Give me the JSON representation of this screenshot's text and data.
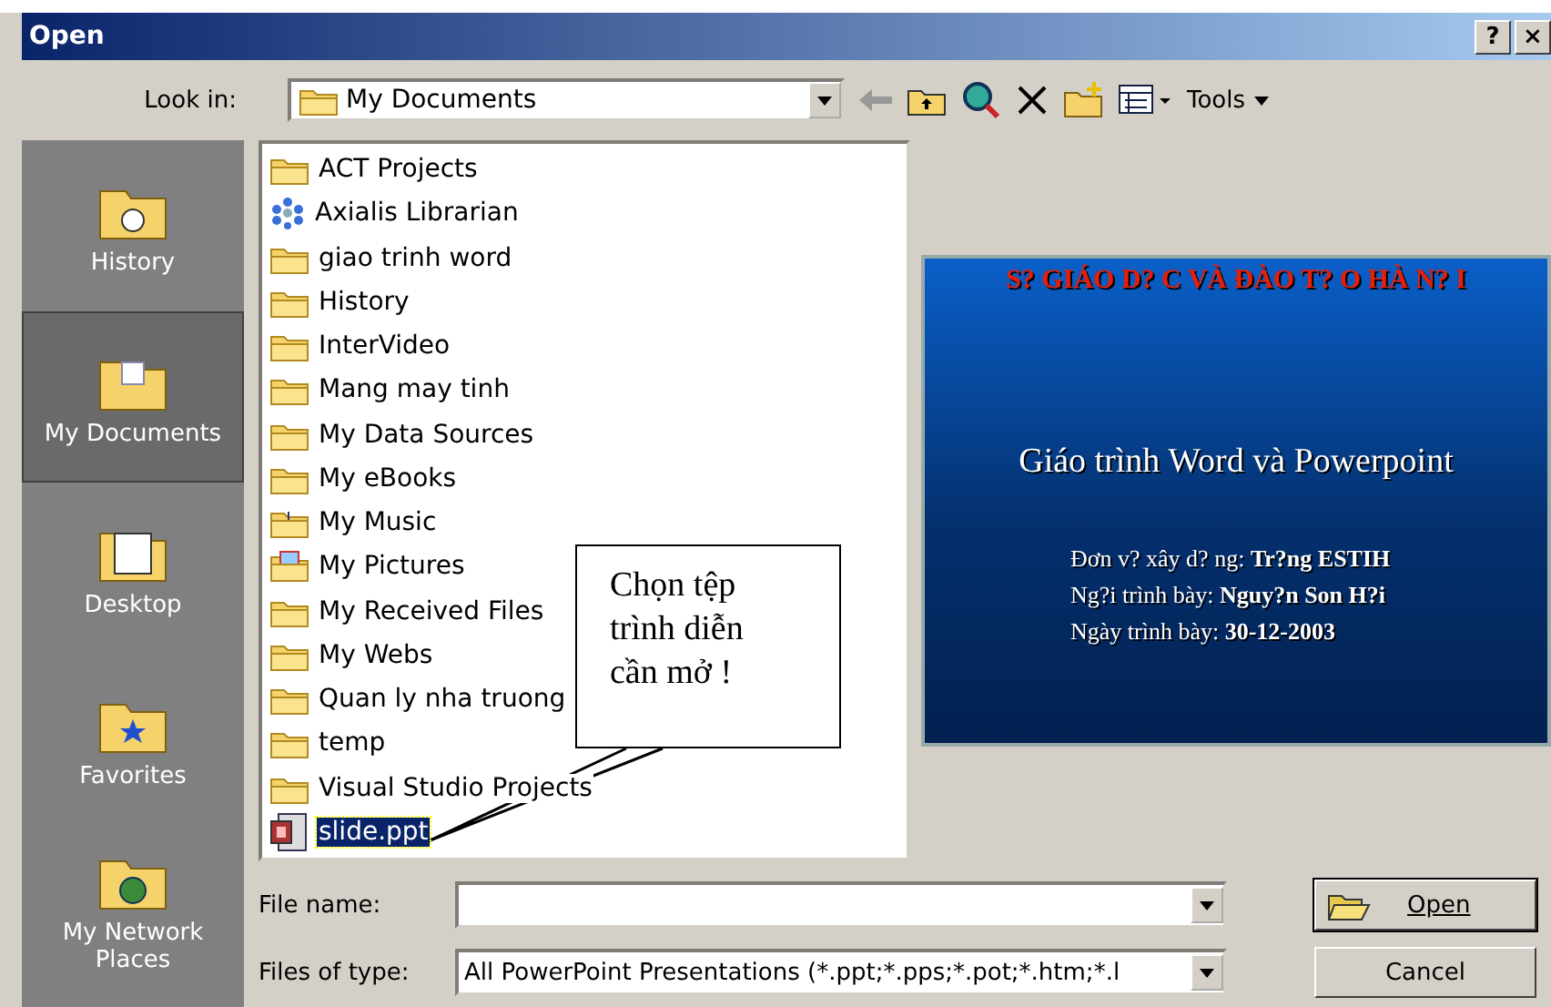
{
  "window": {
    "title": "Open",
    "help_button": "?",
    "close_button": "×"
  },
  "toolbar": {
    "look_in_label": "Look in:",
    "look_in_value": "My Documents",
    "tools": "Tools"
  },
  "places": [
    {
      "label": "History",
      "kind": "history",
      "selected": false
    },
    {
      "label": "My Documents",
      "kind": "documents",
      "selected": true
    },
    {
      "label": "Desktop",
      "kind": "desktop",
      "selected": false
    },
    {
      "label": "Favorites",
      "kind": "favorites",
      "selected": false
    },
    {
      "label": "My Network Places",
      "kind": "network",
      "selected": false
    }
  ],
  "files": [
    {
      "name": "ACT Projects",
      "kind": "folder",
      "selected": false
    },
    {
      "name": "Axialis Librarian",
      "kind": "app",
      "selected": false
    },
    {
      "name": "giao trinh word",
      "kind": "folder",
      "selected": false
    },
    {
      "name": "History",
      "kind": "folder",
      "selected": false
    },
    {
      "name": "InterVideo",
      "kind": "folder",
      "selected": false
    },
    {
      "name": "Mang may tinh",
      "kind": "folder",
      "selected": false
    },
    {
      "name": "My Data Sources",
      "kind": "folder",
      "selected": false
    },
    {
      "name": "My eBooks",
      "kind": "folder",
      "selected": false
    },
    {
      "name": "My Music",
      "kind": "music",
      "selected": false
    },
    {
      "name": "My Pictures",
      "kind": "pictures",
      "selected": false
    },
    {
      "name": "My Received Files",
      "kind": "folder",
      "selected": false
    },
    {
      "name": "My Webs",
      "kind": "folder",
      "selected": false
    },
    {
      "name": "Quan ly nha truong",
      "kind": "folder",
      "selected": false
    },
    {
      "name": "temp",
      "kind": "folder",
      "selected": false
    },
    {
      "name": "Visual Studio Projects",
      "kind": "folder",
      "selected": false
    },
    {
      "name": "slide.ppt",
      "kind": "ppt",
      "selected": true
    }
  ],
  "preview": {
    "heading": "S?  GIÁO D? C VÀ ĐÀO T? O HÀ N? I",
    "title": "Giáo trình Word và Powerpoint",
    "lines": [
      "Đơn v? xây d? ng: **Tr?ng ESTIH**",
      "Ng?i trình bày: **Nguy?n Son H?i**",
      "Ngày trình bày: **30-12-2003**"
    ]
  },
  "callout": "Chọn tệp trình diễn cần mở !",
  "file_name": {
    "label": "File name:"
  },
  "file_type": {
    "label": "Files of type:",
    "value": "All PowerPoint Presentations (*.ppt;*.pps;*.pot;*.htm;*.l"
  },
  "buttons": {
    "open": "Open",
    "cancel": "Cancel"
  }
}
